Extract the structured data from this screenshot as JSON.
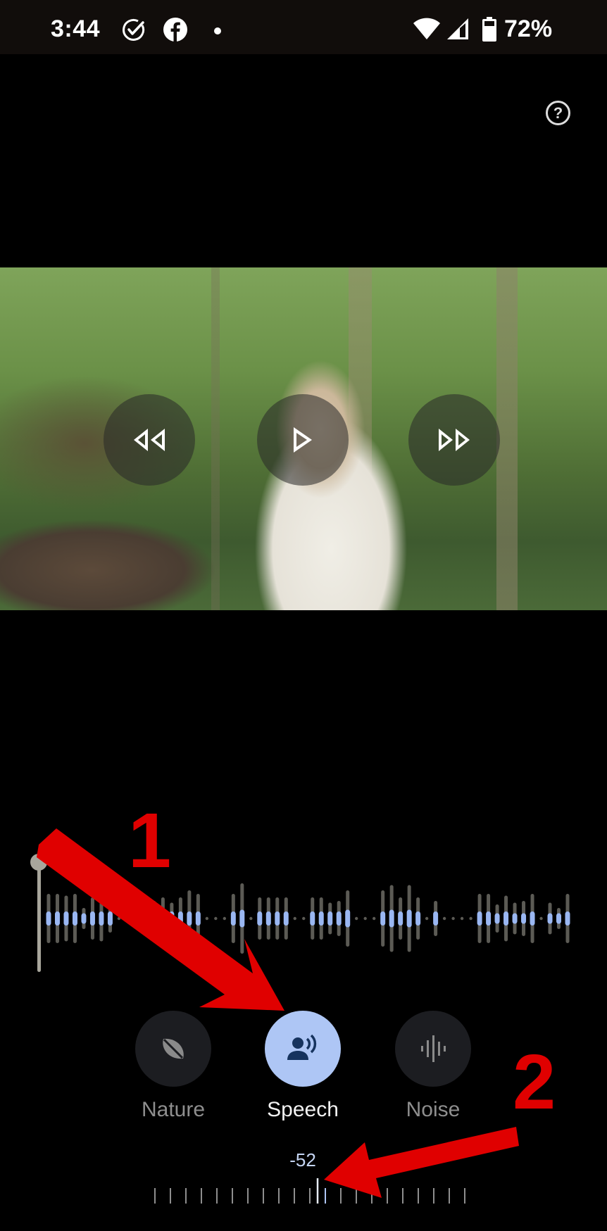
{
  "status_bar": {
    "time": "3:44",
    "notification_icons": [
      "check-circle-icon",
      "facebook-icon",
      "dot-icon"
    ],
    "system_icons": [
      "wifi-icon",
      "cellular-signal-icon",
      "battery-icon"
    ],
    "battery_percent": "72%"
  },
  "header": {
    "help_icon": "help-circle-icon",
    "help_glyph": "?"
  },
  "video": {
    "controls": [
      {
        "name": "rewind",
        "icon": "rewind-icon"
      },
      {
        "name": "play",
        "icon": "play-icon"
      },
      {
        "name": "fast-forward",
        "icon": "fast-forward-icon"
      }
    ],
    "description": "Man in white long-sleeve shirt holding audio recorder in a forest by a stream"
  },
  "waveform": {
    "playhead_position": 0,
    "bars": [
      {
        "h": 0.7,
        "c": 0.2
      },
      {
        "h": 0.7,
        "c": 0.2
      },
      {
        "h": 0.65,
        "c": 0.2
      },
      {
        "h": 0.7,
        "c": 0.2
      },
      {
        "h": 0.3,
        "c": 0.15
      },
      {
        "h": 0.6,
        "c": 0.2
      },
      {
        "h": 0.65,
        "c": 0.2
      },
      {
        "h": 0.4,
        "c": 0.2
      },
      {
        "h": 0,
        "c": 0
      },
      {
        "h": 0,
        "c": 0
      },
      {
        "h": 0,
        "c": 0
      },
      {
        "h": 0.35,
        "c": 0.1
      },
      {
        "h": 0.5,
        "c": 0.15
      },
      {
        "h": 0.6,
        "c": 0.2
      },
      {
        "h": 0.45,
        "c": 0.2
      },
      {
        "h": 0.6,
        "c": 0.2
      },
      {
        "h": 0.8,
        "c": 0.2
      },
      {
        "h": 0.7,
        "c": 0.2
      },
      {
        "h": 0,
        "c": 0
      },
      {
        "h": 0,
        "c": 0
      },
      {
        "h": 0,
        "c": 0
      },
      {
        "h": 0.7,
        "c": 0.2
      },
      {
        "h": 1.0,
        "c": 0.25
      },
      {
        "h": 0,
        "c": 0
      },
      {
        "h": 0.6,
        "c": 0.2
      },
      {
        "h": 0.6,
        "c": 0.2
      },
      {
        "h": 0.6,
        "c": 0.2
      },
      {
        "h": 0.6,
        "c": 0.2
      },
      {
        "h": 0,
        "c": 0
      },
      {
        "h": 0,
        "c": 0
      },
      {
        "h": 0.6,
        "c": 0.2
      },
      {
        "h": 0.6,
        "c": 0.2
      },
      {
        "h": 0.45,
        "c": 0.2
      },
      {
        "h": 0.5,
        "c": 0.2
      },
      {
        "h": 0.8,
        "c": 0.25
      },
      {
        "h": 0,
        "c": 0
      },
      {
        "h": 0,
        "c": 0
      },
      {
        "h": 0,
        "c": 0
      },
      {
        "h": 0.8,
        "c": 0.2
      },
      {
        "h": 0.95,
        "c": 0.25
      },
      {
        "h": 0.6,
        "c": 0.2
      },
      {
        "h": 0.95,
        "c": 0.25
      },
      {
        "h": 0.6,
        "c": 0.2
      },
      {
        "h": 0,
        "c": 0
      },
      {
        "h": 0.5,
        "c": 0.2
      },
      {
        "h": 0,
        "c": 0
      },
      {
        "h": 0,
        "c": 0
      },
      {
        "h": 0,
        "c": 0
      },
      {
        "h": 0,
        "c": 0
      },
      {
        "h": 0.7,
        "c": 0.2
      },
      {
        "h": 0.7,
        "c": 0.2
      },
      {
        "h": 0.4,
        "c": 0.15
      },
      {
        "h": 0.65,
        "c": 0.2
      },
      {
        "h": 0.45,
        "c": 0.15
      },
      {
        "h": 0.5,
        "c": 0.15
      },
      {
        "h": 0.7,
        "c": 0.2
      },
      {
        "h": 0,
        "c": 0
      },
      {
        "h": 0.45,
        "c": 0.15
      },
      {
        "h": 0.3,
        "c": 0.15
      },
      {
        "h": 0.7,
        "c": 0.2
      }
    ],
    "bar_color": "#5c5b55",
    "center_color": "#9ab7f2"
  },
  "modes": [
    {
      "label": "Nature",
      "icon": "leaf-icon",
      "active": false
    },
    {
      "label": "Speech",
      "icon": "speaker-person-icon",
      "active": true
    },
    {
      "label": "Noise",
      "icon": "waveform-icon",
      "active": false
    }
  ],
  "level_slider": {
    "value": "-52",
    "tick_count": 21,
    "selected_tick_index": 10
  },
  "annotations": {
    "label_1": "1",
    "label_2": "2",
    "color": "#e00000"
  }
}
